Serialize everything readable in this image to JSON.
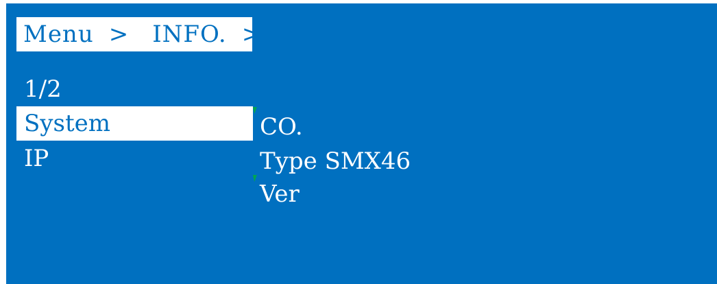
{
  "breadcrumb": {
    "root": "Menu",
    "separator": ">",
    "current": "INFO.",
    "trailing_separator": ">"
  },
  "page_indicator": "1/2",
  "menu": {
    "items": [
      {
        "label": "System",
        "selected": true
      },
      {
        "label": "IP",
        "selected": false
      }
    ]
  },
  "info": {
    "company_label": "CO.",
    "type_line": "Type SMX46",
    "version_label": "Ver"
  },
  "colors": {
    "background": "#0070c0",
    "highlight": "#ffffff",
    "cursor_mark": "#00a651"
  }
}
